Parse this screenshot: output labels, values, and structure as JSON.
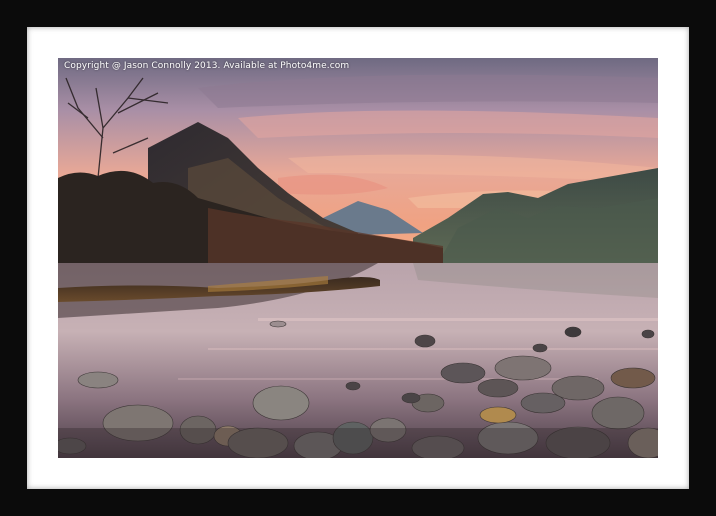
{
  "photo": {
    "copyright": "Copyright @ Jason Connolly 2013. Available at Photo4me.com"
  },
  "colors": {
    "frame": "#0b0b0b",
    "mount": "#ffffff",
    "sky_top": "#7b6f86",
    "sky_glow": "#f3a183",
    "water": "#b79da4"
  }
}
